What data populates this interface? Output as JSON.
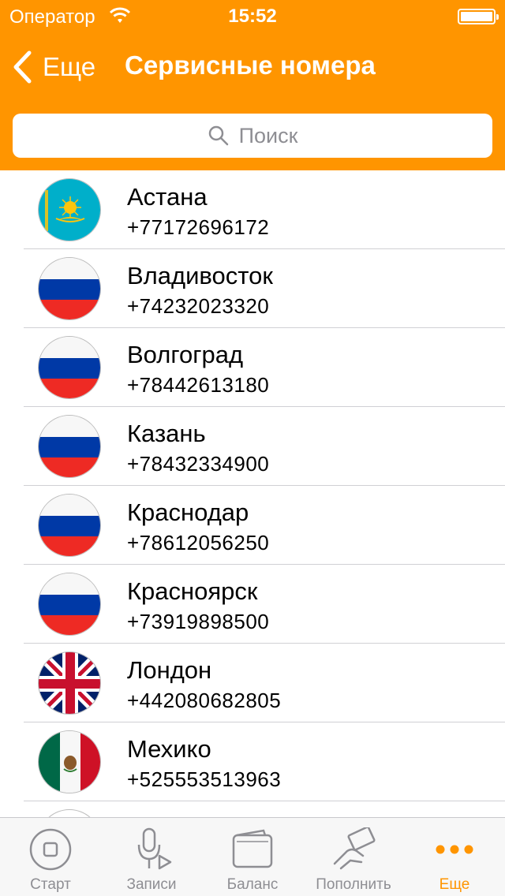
{
  "status_bar": {
    "carrier": "Оператор",
    "time": "15:52"
  },
  "nav": {
    "back_label": "Еще",
    "title": "Сервисные номера"
  },
  "search": {
    "placeholder": "Поиск"
  },
  "colors": {
    "accent": "#FF9500",
    "inactive": "#8e8e93",
    "separator": "#d0d0d4"
  },
  "contacts": [
    {
      "city": "Астана",
      "phone": "+77172696172",
      "flag": "kazakhstan-flag-icon"
    },
    {
      "city": "Владивосток",
      "phone": "+74232023320",
      "flag": "russia-flag-icon"
    },
    {
      "city": "Волгоград",
      "phone": "+78442613180",
      "flag": "russia-flag-icon"
    },
    {
      "city": "Казань",
      "phone": "+78432334900",
      "flag": "russia-flag-icon"
    },
    {
      "city": "Краснодар",
      "phone": "+78612056250",
      "flag": "russia-flag-icon"
    },
    {
      "city": "Красноярск",
      "phone": "+73919898500",
      "flag": "russia-flag-icon"
    },
    {
      "city": "Лондон",
      "phone": "+442080682805",
      "flag": "uk-flag-icon"
    },
    {
      "city": "Мехико",
      "phone": "+525553513963",
      "flag": "mexico-flag-icon"
    }
  ],
  "tabs": [
    {
      "label": "Старт",
      "icon": "home-button-icon",
      "active": false
    },
    {
      "label": "Записи",
      "icon": "microphone-play-icon",
      "active": false
    },
    {
      "label": "Баланс",
      "icon": "wallet-icon",
      "active": false
    },
    {
      "label": "Пополнить",
      "icon": "hand-money-icon",
      "active": false
    },
    {
      "label": "Еще",
      "icon": "more-dots-icon",
      "active": true
    }
  ]
}
